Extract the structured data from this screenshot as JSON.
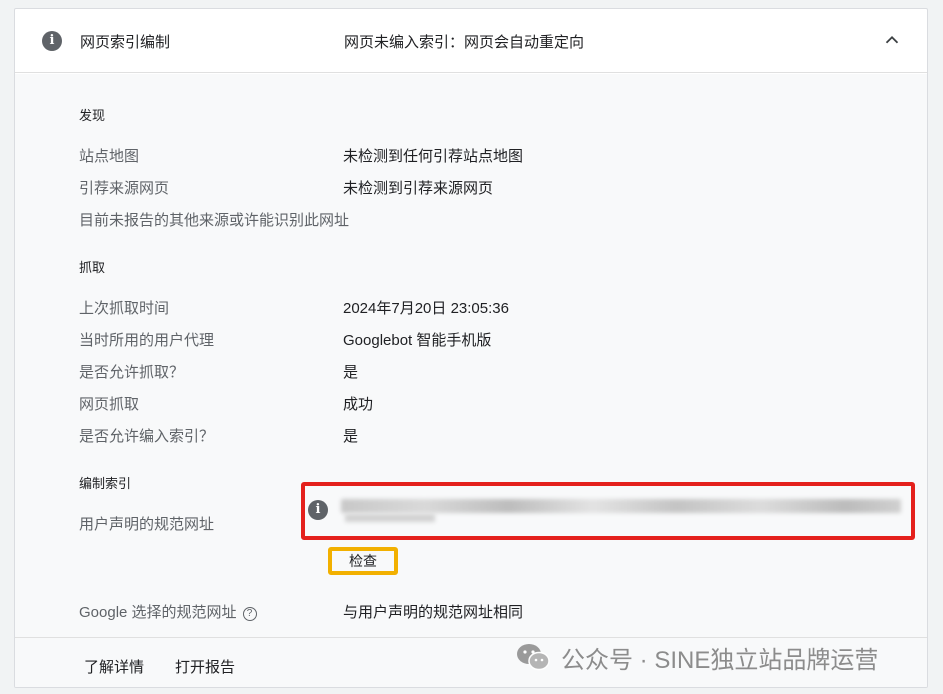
{
  "header": {
    "title": "网页索引编制",
    "status": "网页未编入索引：网页会自动重定向"
  },
  "discovery": {
    "section_title": "发现",
    "rows": [
      {
        "label": "站点地图",
        "value": "未检测到任何引荐站点地图"
      },
      {
        "label": "引荐来源网页",
        "value": "未检测到引荐来源网页"
      }
    ],
    "note": "目前未报告的其他来源或许能识别此网址"
  },
  "crawl": {
    "section_title": "抓取",
    "rows": [
      {
        "label": "上次抓取时间",
        "value": "2024年7月20日 23:05:36"
      },
      {
        "label": "当时所用的用户代理",
        "value": "Googlebot 智能手机版"
      },
      {
        "label": "是否允许抓取？",
        "value": "是"
      },
      {
        "label": "网页抓取",
        "value": "成功"
      },
      {
        "label": "是否允许编入索引？",
        "value": "是"
      }
    ]
  },
  "indexing": {
    "section_title": "编制索引",
    "user_canonical_label": "用户声明的规范网址",
    "inspect_label": "检查",
    "google_canonical_label": "Google 选择的规范网址",
    "google_canonical_value": "与用户声明的规范网址相同"
  },
  "footer": {
    "learn_more": "了解详情",
    "open_report": "打开报告"
  },
  "watermark": {
    "text": "公众号 · SINE独立站品牌运营"
  },
  "icons": {
    "info": "info-icon",
    "collapse": "chevron-up-icon",
    "help": "help-circle-icon",
    "wechat": "wechat-icon"
  },
  "colors": {
    "highlight_red": "#e4201c",
    "highlight_yellow": "#f2b000",
    "icon_gray": "#5f6368"
  }
}
